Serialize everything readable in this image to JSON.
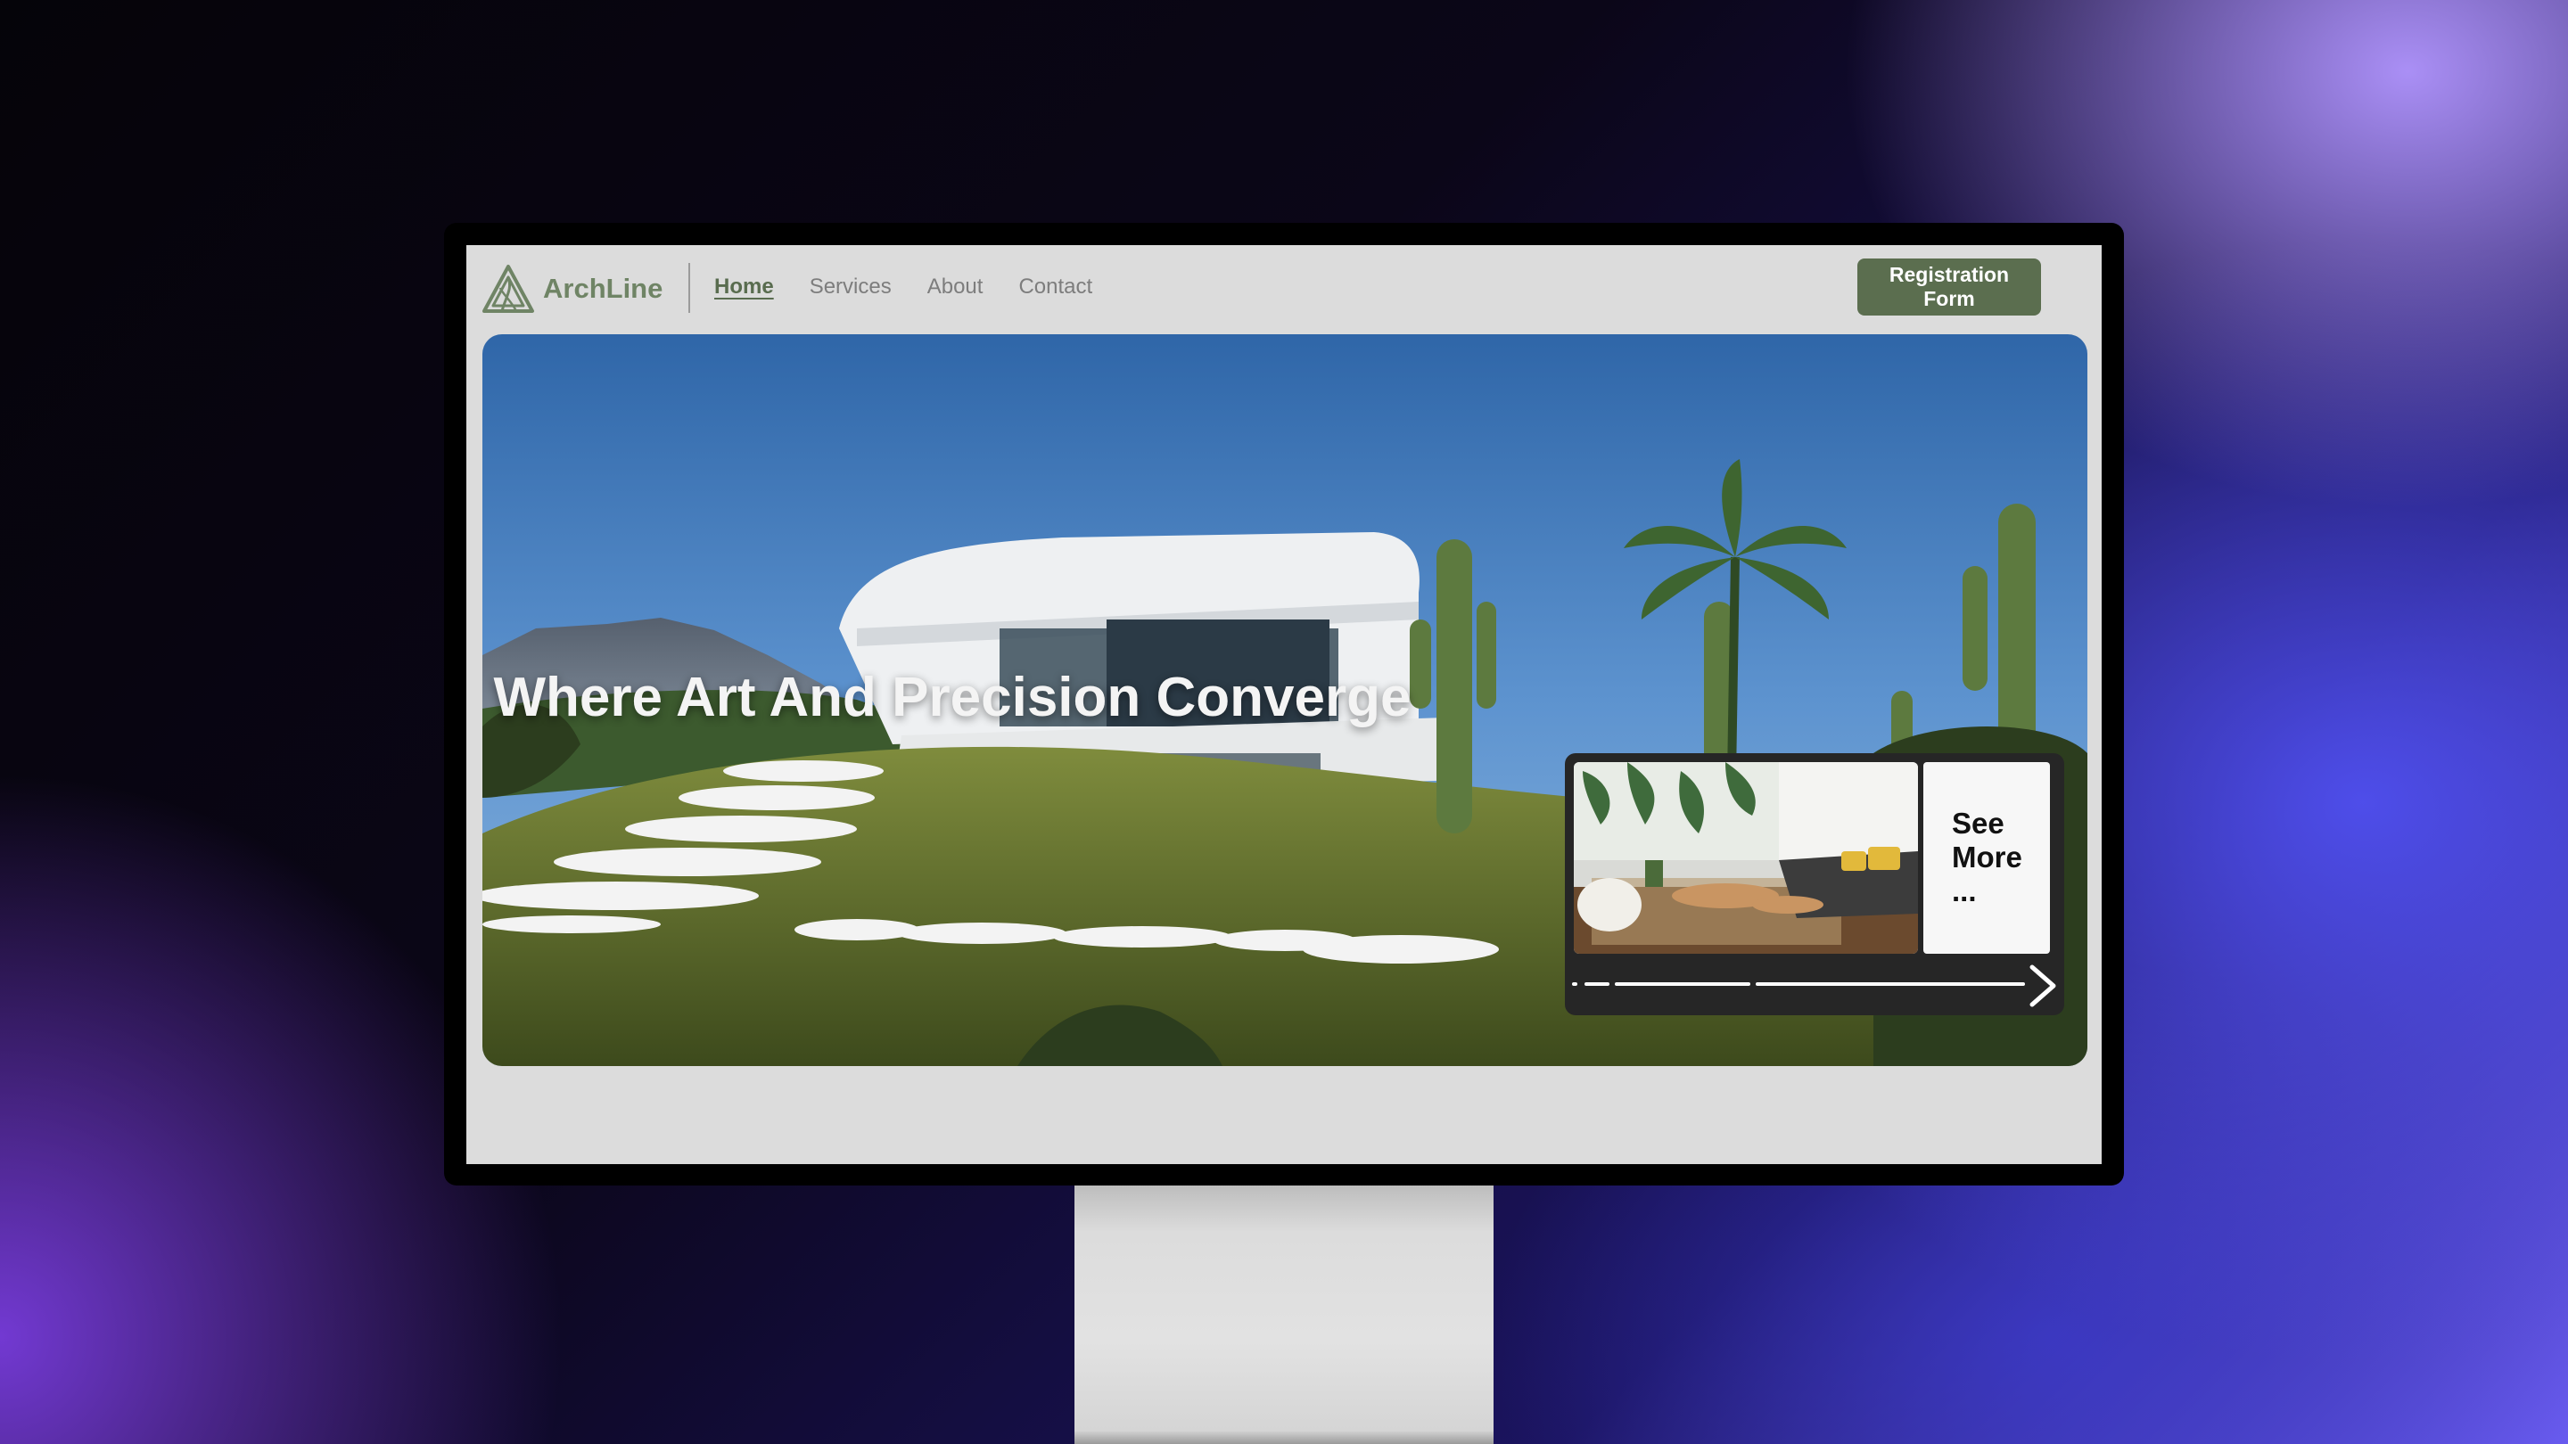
{
  "app": {
    "logo_text": "ArchLine",
    "logo_icon": "triangle-swirl-logo"
  },
  "nav": {
    "links": [
      {
        "label": "Home",
        "active": true
      },
      {
        "label": "Services",
        "active": false
      },
      {
        "label": "About",
        "active": false
      },
      {
        "label": "Contact",
        "active": false
      }
    ],
    "cta_label": "Registration Form"
  },
  "hero": {
    "headline": "Where Art And Precision Converge"
  },
  "carousel": {
    "see_more_label": "See\nMore\n...",
    "next_icon": "chevron-right-icon"
  },
  "colors": {
    "brand": "#6f8465",
    "cta": "#5b6e4f",
    "screen_bg": "#dcdcdc"
  }
}
